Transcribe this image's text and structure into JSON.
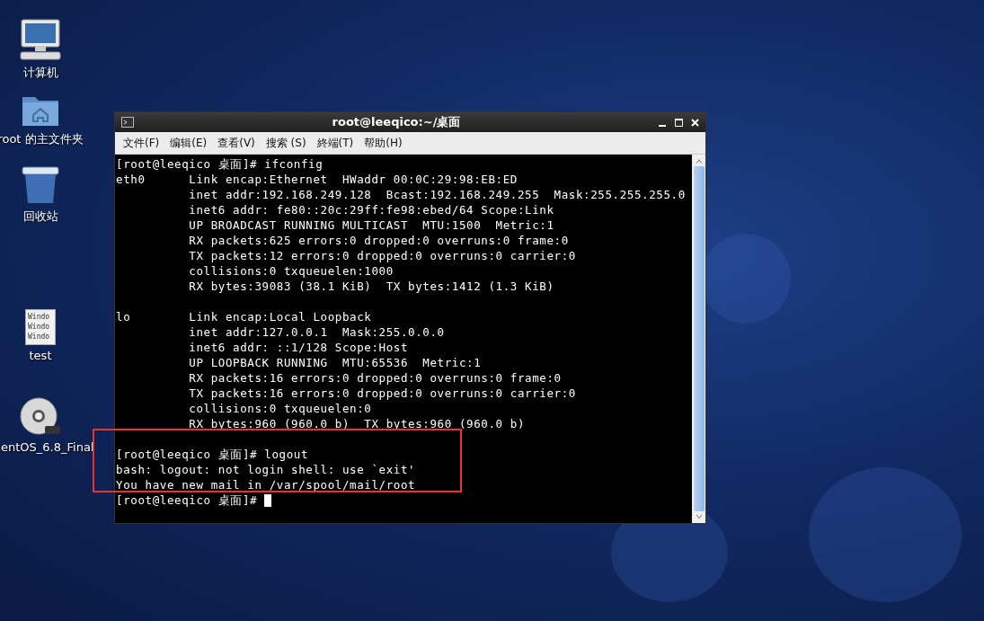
{
  "desktop_icons": [
    {
      "kind": "computer",
      "label": "计算机"
    },
    {
      "kind": "folder",
      "label": "root 的主文件夹"
    },
    {
      "kind": "trash",
      "label": "回收站"
    },
    {
      "kind": "file",
      "label": "test",
      "preview": [
        "Windo",
        "Windo",
        "Windo"
      ]
    },
    {
      "kind": "dvd",
      "label": "entOS_6.8_Final"
    }
  ],
  "window": {
    "title": "root@leeqico:~/桌面",
    "menu": [
      "文件(F)",
      "编辑(E)",
      "查看(V)",
      "搜索 (S)",
      "終端(T)",
      "帮助(H)"
    ],
    "paragraphs": [
      [
        "[root@leeqico 桌面]# ifconfig",
        "eth0      Link encap:Ethernet  HWaddr 00:0C:29:98:EB:ED",
        "          inet addr:192.168.249.128  Bcast:192.168.249.255  Mask:255.255.255.0",
        "          inet6 addr: fe80::20c:29ff:fe98:ebed/64 Scope:Link",
        "          UP BROADCAST RUNNING MULTICAST  MTU:1500  Metric:1",
        "          RX packets:625 errors:0 dropped:0 overruns:0 frame:0",
        "          TX packets:12 errors:0 dropped:0 overruns:0 carrier:0",
        "          collisions:0 txqueuelen:1000",
        "          RX bytes:39083 (38.1 KiB)  TX bytes:1412 (1.3 KiB)"
      ],
      [
        "lo        Link encap:Local Loopback",
        "          inet addr:127.0.0.1  Mask:255.0.0.0",
        "          inet6 addr: ::1/128 Scope:Host",
        "          UP LOOPBACK RUNNING  MTU:65536  Metric:1",
        "          RX packets:16 errors:0 dropped:0 overruns:0 frame:0",
        "          TX packets:16 errors:0 dropped:0 overruns:0 carrier:0",
        "          collisions:0 txqueuelen:0",
        "          RX bytes:960 (960.0 b)  TX bytes:960 (960.0 b)"
      ],
      [
        "[root@leeqico 桌面]# logout",
        "bash: logout: not login shell: use `exit'",
        "You have new mail in /var/spool/mail/root",
        "[root@leeqico 桌面]# "
      ]
    ]
  }
}
